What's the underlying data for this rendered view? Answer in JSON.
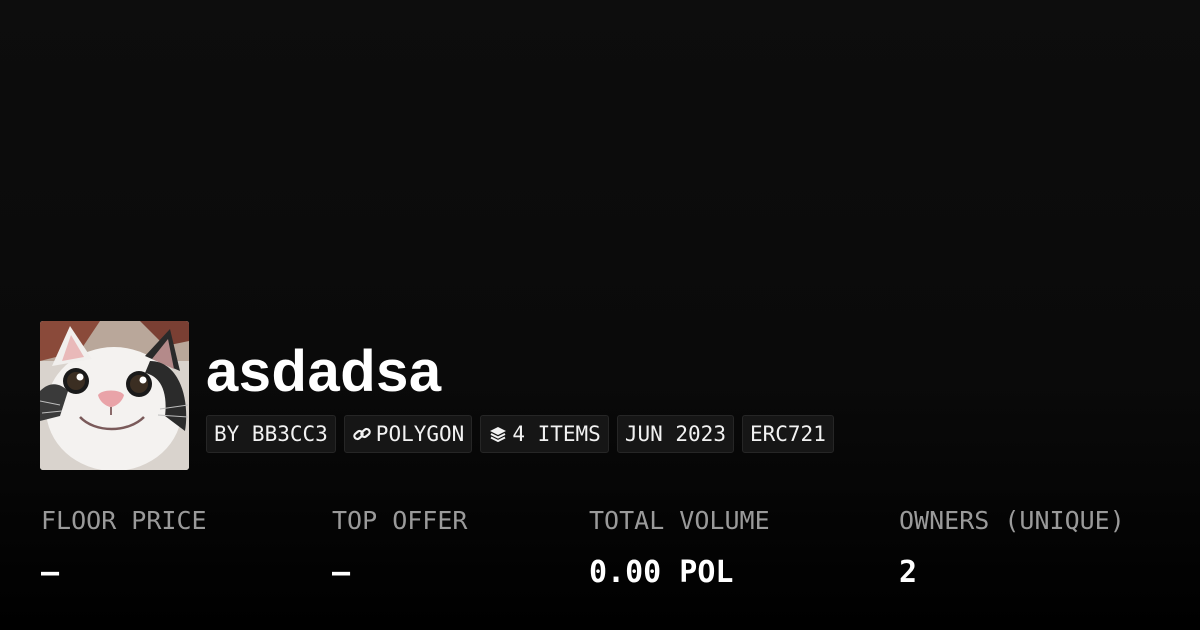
{
  "collection": {
    "name": "asdadsa",
    "avatar_icon": "cat-avatar",
    "tags": {
      "creator": "BY BB3CC3",
      "chain": "POLYGON",
      "chain_icon": "link-icon",
      "items": "4 ITEMS",
      "items_icon": "layers-icon",
      "date": "JUN 2023",
      "standard": "ERC721"
    }
  },
  "stats": {
    "floor_price": {
      "label": "FLOOR PRICE",
      "value": "–"
    },
    "top_offer": {
      "label": "TOP OFFER",
      "value": "–"
    },
    "total_volume": {
      "label": "TOTAL VOLUME",
      "value": "0.00 POL"
    },
    "owners": {
      "label": "OWNERS (UNIQUE)",
      "value": "2"
    }
  },
  "colors": {
    "background": "#0b0b0b",
    "text": "#ffffff",
    "muted": "#9a9a9a",
    "tag_bg": "#161616"
  }
}
